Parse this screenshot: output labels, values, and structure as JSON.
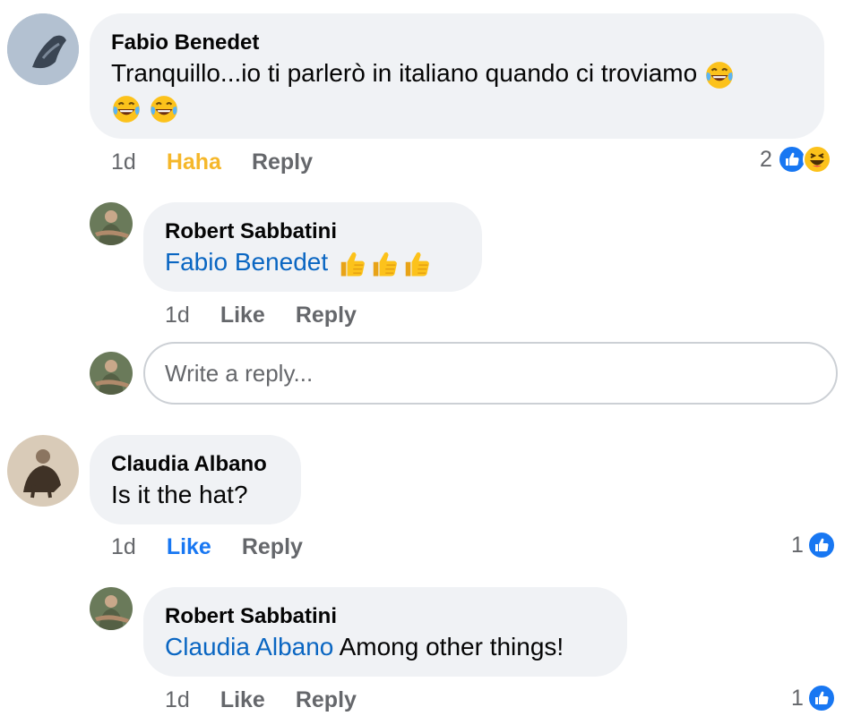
{
  "comments": [
    {
      "author": "Fabio Benedet",
      "text": "Tranquillo...io ti parlerò in italiano quando ci troviamo",
      "time": "1d",
      "react_label": "Haha",
      "reply_label": "Reply",
      "reaction_count": "2"
    },
    {
      "author": "Robert Sabbatini",
      "mention": "Fabio Benedet",
      "time": "1d",
      "like_label": "Like",
      "reply_label": "Reply"
    },
    {
      "author": "Claudia Albano",
      "text": "Is it the hat?",
      "time": "1d",
      "like_label": "Like",
      "reply_label": "Reply",
      "reaction_count": "1"
    },
    {
      "author": "Robert Sabbatini",
      "mention": "Claudia Albano",
      "text": " Among other things!",
      "time": "1d",
      "like_label": "Like",
      "reply_label": "Reply",
      "reaction_count": "1"
    }
  ],
  "reply_box": {
    "placeholder": "Write a reply..."
  },
  "colors": {
    "link": "#0a66c2",
    "like_blue": "#1877f2",
    "haha_yellow": "#f5b72a",
    "bubble": "#f0f2f5",
    "meta": "#65676b"
  }
}
